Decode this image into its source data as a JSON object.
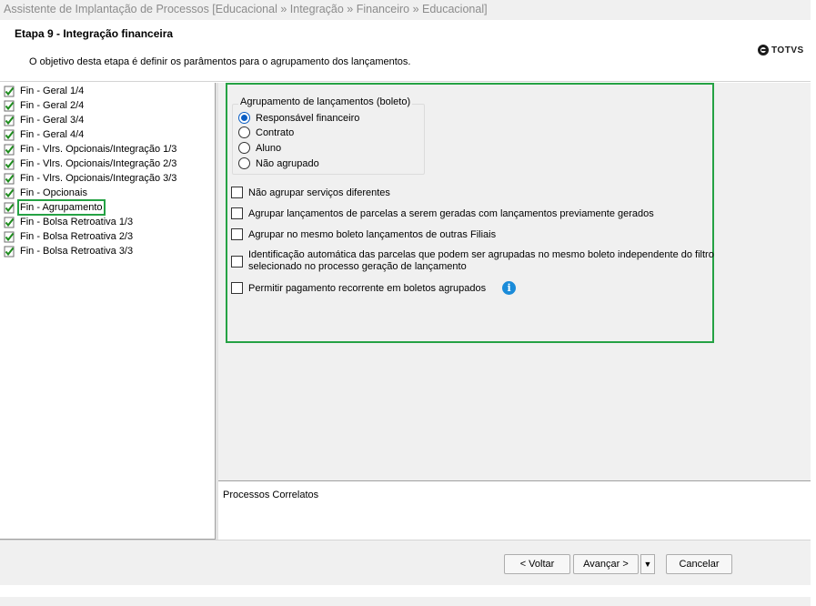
{
  "window": {
    "title": "Assistente de Implantação de Processos [Educacional » Integração » Financeiro » Educacional]"
  },
  "header": {
    "step_title": "Etapa 9 - Integração financeira",
    "description": "O objetivo desta etapa é definir os parâmentos para o agrupamento dos lançamentos.",
    "logo_text": "TOTVS"
  },
  "tree": {
    "items": [
      {
        "label": "Fin - Geral 1/4",
        "checked": true
      },
      {
        "label": "Fin - Geral 2/4",
        "checked": true
      },
      {
        "label": "Fin - Geral 3/4",
        "checked": true
      },
      {
        "label": "Fin - Geral 4/4",
        "checked": true
      },
      {
        "label": "Fin - Vlrs. Opcionais/Integração 1/3",
        "checked": true
      },
      {
        "label": "Fin - Vlrs. Opcionais/Integração 2/3",
        "checked": true
      },
      {
        "label": "Fin - Vlrs. Opcionais/Integração 3/3",
        "checked": true
      },
      {
        "label": "Fin - Opcionais",
        "checked": true
      },
      {
        "label": "Fin - Agrupamento",
        "checked": true,
        "selected": true
      },
      {
        "label": "Fin - Bolsa Retroativa 1/3",
        "checked": true
      },
      {
        "label": "Fin - Bolsa Retroativa 2/3",
        "checked": true
      },
      {
        "label": "Fin - Bolsa Retroativa 3/3",
        "checked": true
      }
    ]
  },
  "grouping": {
    "title": "Agrupamento de lançamentos (boleto)",
    "options": [
      {
        "label": "Responsável financeiro",
        "selected": true
      },
      {
        "label": "Contrato",
        "selected": false
      },
      {
        "label": "Aluno",
        "selected": false
      },
      {
        "label": "Não agrupado",
        "selected": false
      }
    ]
  },
  "checkboxes": [
    {
      "label": "Não agrupar serviços diferentes",
      "checked": false
    },
    {
      "label": "Agrupar lançamentos de parcelas a serem geradas com lançamentos previamente gerados",
      "checked": false
    },
    {
      "label": "Agrupar no mesmo boleto lançamentos de outras Filiais",
      "checked": false
    },
    {
      "label": "Identificação automática das parcelas que podem ser agrupadas no mesmo boleto independente do filtro selecionado no processo geração de lançamento",
      "checked": false
    },
    {
      "label": "Permitir pagamento recorrente em boletos agrupados",
      "checked": false
    }
  ],
  "info_icon": {
    "glyph": "i",
    "color": "#1a8bd9"
  },
  "related": {
    "label": "Processos Correlatos"
  },
  "footer": {
    "back_label": "< Voltar",
    "next_label": "Avançar >",
    "dropdown_glyph": "▼",
    "cancel_label": "Cancelar"
  },
  "colors": {
    "highlight": "#25a244",
    "radio_selected": "#0a5ec4"
  }
}
